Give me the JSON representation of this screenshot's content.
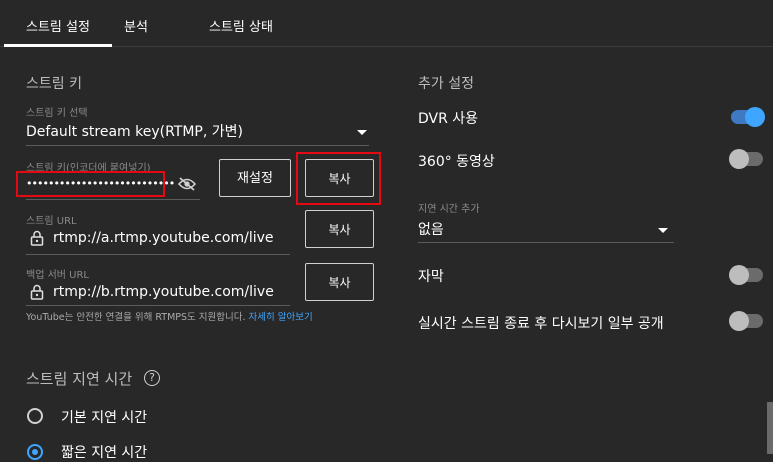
{
  "tabs": [
    {
      "label": "스트림 설정",
      "active": true
    },
    {
      "label": "분석",
      "active": false
    },
    {
      "label": "스트림 상태",
      "active": false
    }
  ],
  "stream_key": {
    "section_title": "스트림 키",
    "select_label": "스트림 키 선택",
    "select_value": "Default stream key(RTMP, 가변)",
    "key_label": "스트림 키(인코더에 붙여넣기)",
    "key_value": "•••••••••••••••••••••••••••",
    "reset_button": "재설정",
    "copy_button": "복사"
  },
  "stream_url": {
    "label": "스트림 URL",
    "value": "rtmp://a.rtmp.youtube.com/live",
    "copy_button": "복사"
  },
  "backup_url": {
    "label": "백업 서버 URL",
    "value": "rtmp://b.rtmp.youtube.com/live",
    "copy_button": "복사"
  },
  "rtmps_notice": {
    "text": "YouTube는 안전한 연결을 위해 RTMPS도 지원합니다. ",
    "link": "자세히 알아보기"
  },
  "latency": {
    "section_title": "스트림 지연 시간",
    "options": [
      {
        "label": "기본 지연 시간",
        "checked": false
      },
      {
        "label": "짧은 지연 시간",
        "checked": true
      }
    ]
  },
  "additional": {
    "section_title": "추가 설정",
    "dvr": {
      "label": "DVR 사용",
      "on": true
    },
    "video360": {
      "label": "360° 동영상",
      "on": false
    },
    "delay_label": "지연 시간 추가",
    "delay_value": "없음",
    "captions": {
      "label": "자막",
      "on": false
    },
    "replay": {
      "label": "실시간 스트림 종료 후 다시보기 일부 공개",
      "on": false
    }
  },
  "colors": {
    "background": "#282828",
    "accent": "#3ea6ff",
    "highlight_box": "#e50914"
  },
  "icons": [
    "visibility-off-icon",
    "lock-icon",
    "help-icon",
    "dropdown-caret-icon"
  ]
}
